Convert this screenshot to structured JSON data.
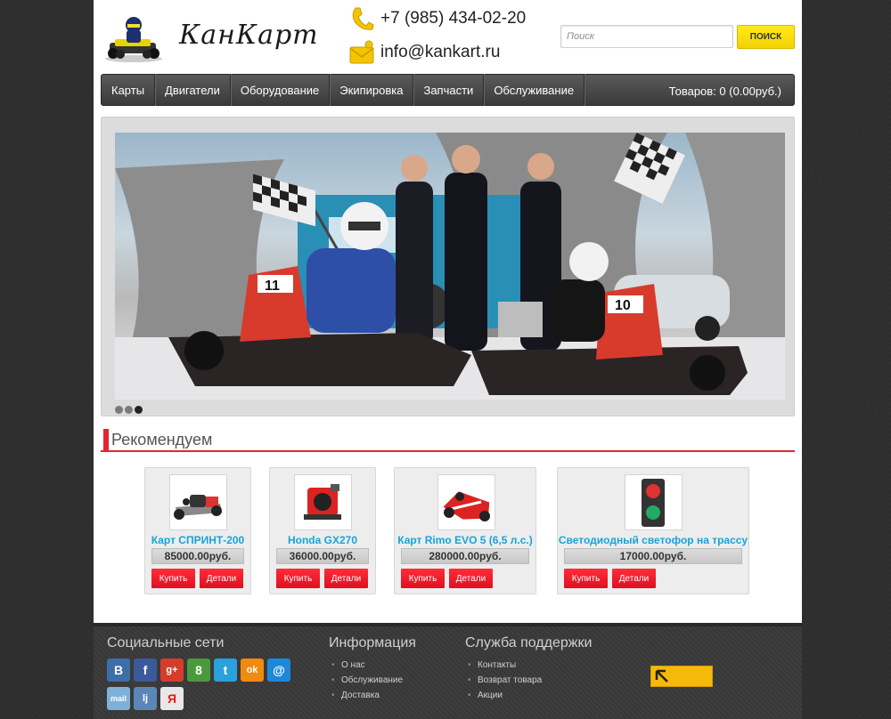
{
  "header": {
    "logo_text": "КанКарт",
    "phone": "+7 (985) 434-02-20",
    "email": "info@kankart.ru",
    "search_placeholder": "Поиск",
    "search_button": "ПОИСК"
  },
  "nav": {
    "items": [
      "Карты",
      "Двигатели",
      "Оборудование",
      "Экипировка",
      "Запчасти",
      "Обслуживание"
    ],
    "cart": "Товаров: 0 (0.00руб.)"
  },
  "slider": {
    "dots": 3,
    "active_dot": 3
  },
  "recommended": {
    "title": "Рекомендуем",
    "products": [
      {
        "name": "Карт СПРИНТ-200",
        "price": "85000.00руб.",
        "buy": "Купить",
        "details": "Детали",
        "image": "kart-sprint-icon"
      },
      {
        "name": "Honda GX270",
        "price": "36000.00руб.",
        "buy": "Купить",
        "details": "Детали",
        "image": "engine-icon"
      },
      {
        "name": "Карт Rimo EVO 5 (6,5 л.с.)",
        "price": "280000.00руб.",
        "buy": "Купить",
        "details": "Детали",
        "image": "kart-rimo-icon"
      },
      {
        "name": "Светодиодный светофор на трассу",
        "price": "17000.00руб.",
        "buy": "Купить",
        "details": "Детали",
        "image": "traffic-light-icon"
      }
    ]
  },
  "footer": {
    "social_title": "Социальные сети",
    "social_icons": [
      "В",
      "f",
      "g+",
      "8",
      "t",
      "ok",
      "@",
      "mail",
      "lj",
      "Я"
    ],
    "info_title": "Информация",
    "info_links": [
      "О нас",
      "Обслуживание",
      "Доставка"
    ],
    "support_title": "Служба поддержки",
    "support_links": [
      "Контакты",
      "Возврат товара",
      "Акции"
    ]
  },
  "colors": {
    "accent_red": "#e4252b",
    "link_blue": "#19a3d8",
    "search_yellow": "#f3d200"
  }
}
